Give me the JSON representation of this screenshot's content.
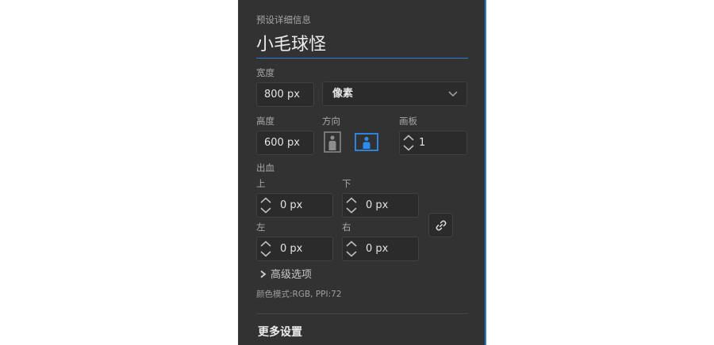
{
  "preset": {
    "section_label": "预设详细信息",
    "name": "小毛球怪"
  },
  "width": {
    "label": "宽度",
    "value": "800 px",
    "unit": "像素",
    "unit_icon": "chevron-down-icon"
  },
  "height": {
    "label": "高度",
    "value": "600 px"
  },
  "orientation": {
    "label": "方向",
    "portrait_icon": "portrait-icon",
    "landscape_icon": "landscape-icon",
    "selected": "landscape"
  },
  "artboards": {
    "label": "画板",
    "value": "1"
  },
  "bleed": {
    "label": "出血",
    "top": {
      "label": "上",
      "value": "0 px"
    },
    "bottom": {
      "label": "下",
      "value": "0 px"
    },
    "left": {
      "label": "左",
      "value": "0 px"
    },
    "right": {
      "label": "右",
      "value": "0 px"
    },
    "link_icon": "link-icon"
  },
  "advanced": {
    "label": "高级选项",
    "icon": "chevron-right-icon"
  },
  "color_mode": "颜色模式:RGB, PPI:72",
  "more_settings": "更多设置",
  "colors": {
    "panel_bg": "#323232",
    "field_bg": "#2b2b2b",
    "accent": "#2d7ad6"
  }
}
